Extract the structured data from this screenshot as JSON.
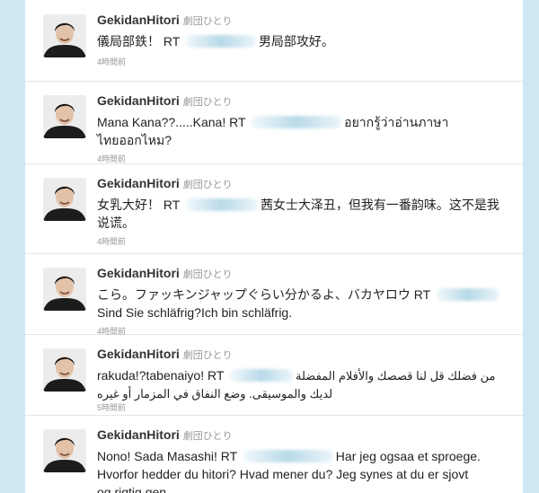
{
  "tweets": [
    {
      "username": "GekidanHitori",
      "display_name": "劇団ひとり",
      "lines": [
        [
          "儀局部鉄！ RT ",
          "男局部攻好。"
        ]
      ],
      "time": "4時間前"
    },
    {
      "username": "GekidanHitori",
      "display_name": "劇団ひとり",
      "lines": [
        [
          "Mana Kana??.....Kana! RT ",
          "อยากรู้ว่าอ่านภาษา"
        ],
        [
          "ไทยออกไหม?"
        ]
      ],
      "time": "4時間前"
    },
    {
      "username": "GekidanHitori",
      "display_name": "劇団ひとり",
      "lines": [
        [
          "女乳大好！ RT ",
          "茜女士大泽丑，但我有一番韵味。这不是我"
        ],
        [
          "说谎。"
        ]
      ],
      "time": "4時間前"
    },
    {
      "username": "GekidanHitori",
      "display_name": "劇団ひとり",
      "lines": [
        [
          "こら。ファッキンジャップぐらい分かるよ、バカヤロウ RT ",
          ""
        ],
        [
          "Sind Sie schläfrig?Ich bin schläfrig."
        ]
      ],
      "time": "4時間前"
    },
    {
      "username": "GekidanHitori",
      "display_name": "劇団ひとり",
      "lines": [
        [
          "rakuda!?tabenaiyo! RT ",
          "من فضلك قل لنا قصصك والأفلام المفضلة"
        ],
        [
          "لديك والموسيقى. وضع النفاق في المزمار أو غيره"
        ]
      ],
      "time": "5時間前"
    },
    {
      "username": "GekidanHitori",
      "display_name": "劇団ひとり",
      "lines": [
        [
          "Nono! Sada Masashi! RT ",
          "Har jeg ogsaa et sproege."
        ],
        [
          "Hvorfor hedder du hitori? Hvad mener du? Jeg synes at du er sjovt"
        ],
        [
          "og rigtig gen"
        ]
      ],
      "time": ""
    }
  ]
}
